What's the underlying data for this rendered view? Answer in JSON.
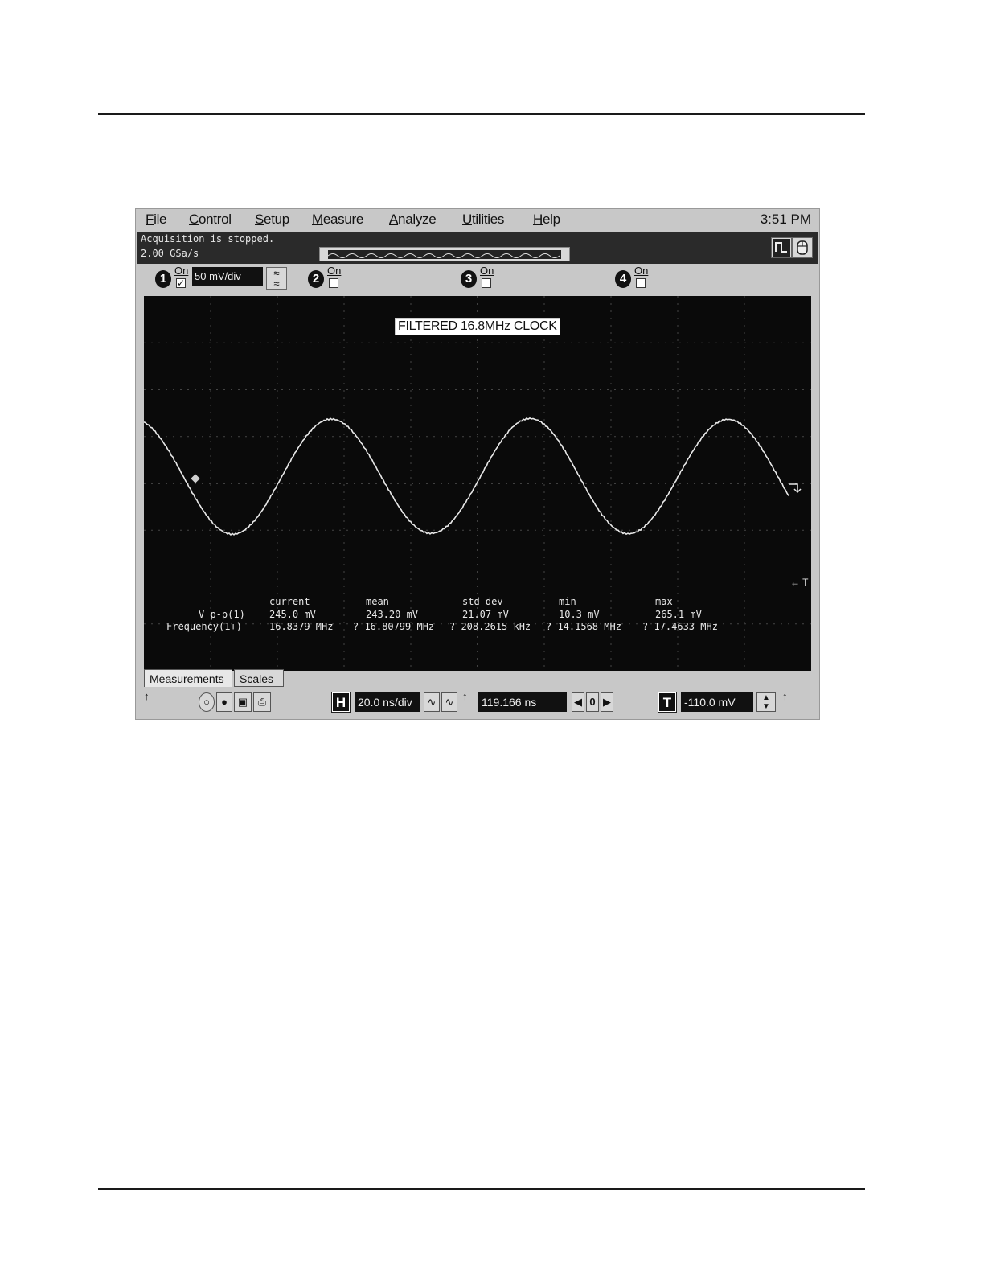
{
  "window": {
    "menu": [
      {
        "label": "File",
        "hotkey": "F",
        "rest": "ile"
      },
      {
        "label": "Control",
        "hotkey": "C",
        "rest": "ontrol"
      },
      {
        "label": "Setup",
        "hotkey": "S",
        "rest": "etup"
      },
      {
        "label": "Measure",
        "hotkey": "M",
        "rest": "easure"
      },
      {
        "label": "Analyze",
        "hotkey": "A",
        "rest": "nalyze"
      },
      {
        "label": "Utilities",
        "hotkey": "U",
        "rest": "tilities"
      },
      {
        "label": "Help",
        "hotkey": "H",
        "rest": "elp"
      }
    ],
    "time": "3:51 PM"
  },
  "status": {
    "acquisition": "Acquisition is stopped.",
    "sample_rate": "2.00 GSa/s"
  },
  "channels": [
    {
      "number": "1",
      "on_label": "On",
      "checked": true,
      "scale": "50 mV/div"
    },
    {
      "number": "2",
      "on_label": "On",
      "checked": false
    },
    {
      "number": "3",
      "on_label": "On",
      "checked": false
    },
    {
      "number": "4",
      "on_label": "On",
      "checked": false
    }
  ],
  "screen": {
    "waveform_label": "FILTERED 16.8MHz CLOCK",
    "trigger_marker": "← T",
    "waveform": {
      "type": "sine",
      "frequency_mhz": 16.8379,
      "amplitude_divisions": 2.45
    }
  },
  "measurements": {
    "headers": [
      "current",
      "mean",
      "std dev",
      "min",
      "max"
    ],
    "rows": [
      {
        "name": "V p-p(1)",
        "current": "245.0 mV",
        "mean": "243.20 mV",
        "std_dev": "21.07 mV",
        "min": "10.3 mV",
        "max": "265.1 mV"
      },
      {
        "name": "Frequency(1+)",
        "current": "16.8379 MHz",
        "mean": "? 16.80799 MHz",
        "std_dev": "? 208.2615 kHz",
        "min": "? 14.1568 MHz",
        "max": "? 17.4633 MHz"
      }
    ]
  },
  "tabs": [
    "Measurements",
    "Scales"
  ],
  "bottom": {
    "horizontal_button": "H",
    "timebase": "20.0 ns/div",
    "delay": "119.166 ns",
    "delay_center": "0",
    "trigger_button": "T",
    "trigger_level": "-110.0 mV"
  }
}
